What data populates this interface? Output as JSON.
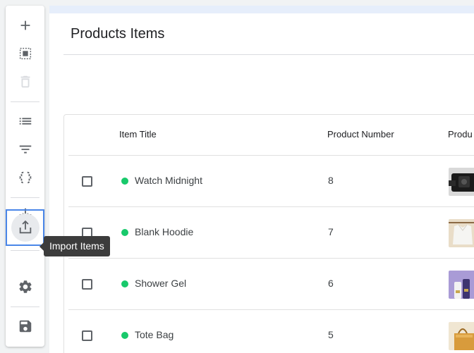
{
  "page": {
    "title": "Products Items"
  },
  "tooltip": {
    "text": "Import Items"
  },
  "toolbar": {
    "buttons": [
      {
        "name": "add-button",
        "icon": "plus-icon"
      },
      {
        "name": "select-all-button",
        "icon": "select-all-icon"
      },
      {
        "name": "delete-button",
        "icon": "trash-icon"
      },
      {
        "name": "list-view-button",
        "icon": "list-icon"
      },
      {
        "name": "filter-button",
        "icon": "filter-icon"
      },
      {
        "name": "code-button",
        "icon": "braces-icon"
      },
      {
        "name": "export-button",
        "icon": "download-icon"
      },
      {
        "name": "import-button",
        "icon": "upload-icon"
      },
      {
        "name": "settings-button",
        "icon": "gear-icon"
      },
      {
        "name": "save-button",
        "icon": "floppy-disk-icon"
      }
    ]
  },
  "table": {
    "columns": [
      "Item Title",
      "Product Number",
      "Produ"
    ],
    "rows": [
      {
        "title": "Watch Midnight",
        "number": "8",
        "thumb": "watch-thumbnail"
      },
      {
        "title": "Blank Hoodie",
        "number": "7",
        "thumb": "hoodie-thumbnail"
      },
      {
        "title": "Shower Gel",
        "number": "6",
        "thumb": "shower-gel-thumbnail"
      },
      {
        "title": "Tote Bag",
        "number": "5",
        "thumb": "tote-bag-thumbnail"
      }
    ]
  },
  "colors": {
    "accent": "#4a86e8",
    "status_active": "#18c96b",
    "tooltip_bg": "#3c3c3c"
  }
}
